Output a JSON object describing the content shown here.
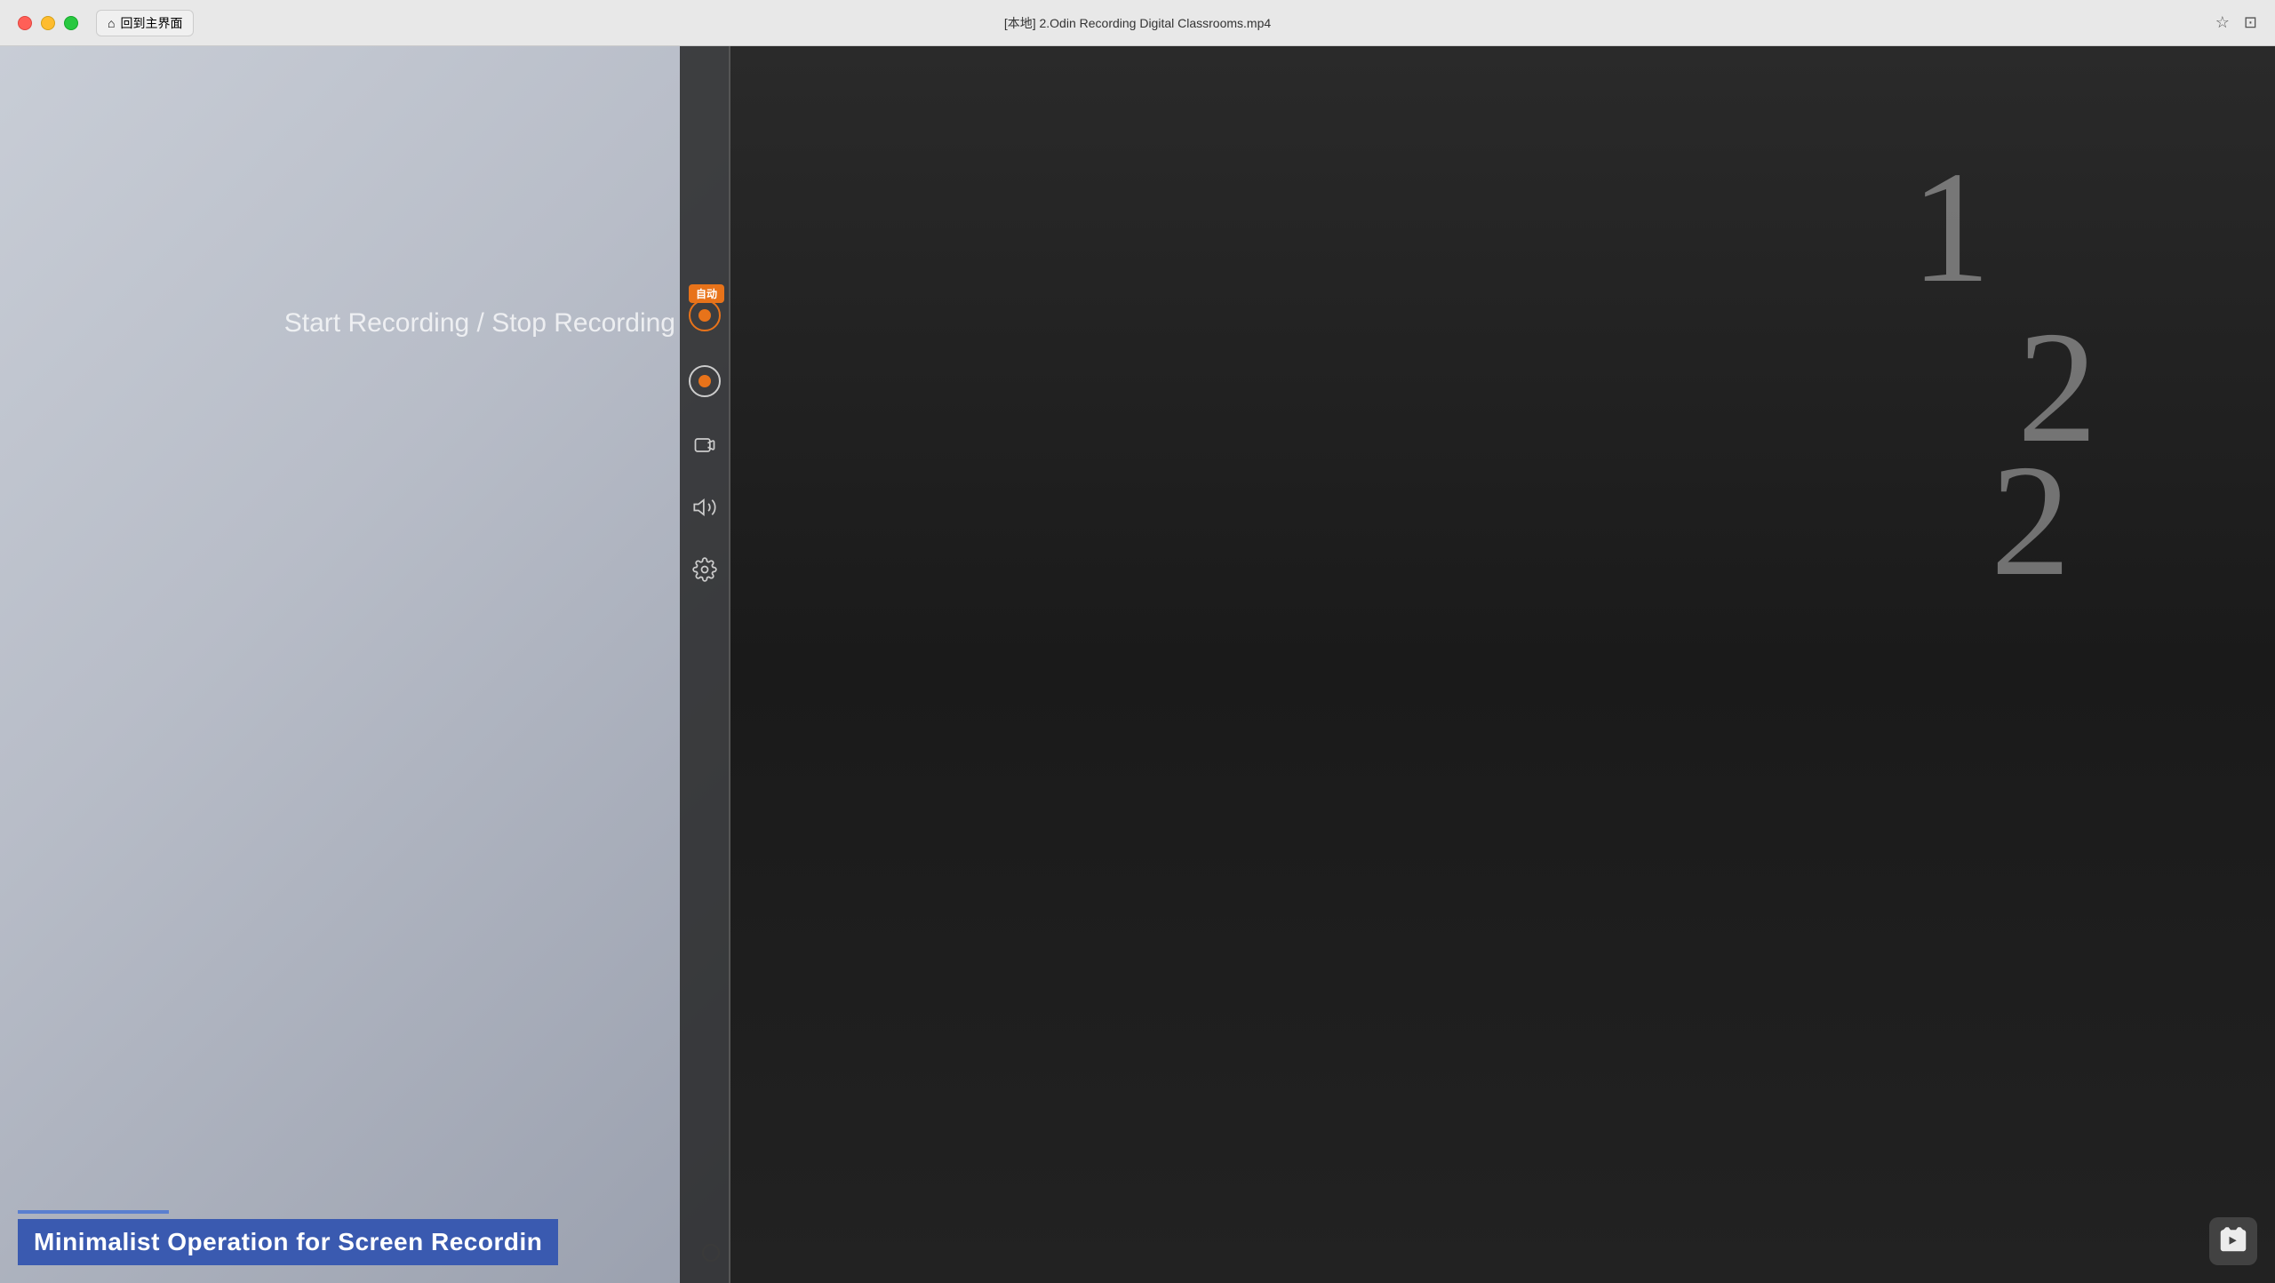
{
  "titlebar": {
    "title": "[本地] 2.Odin Recording Digital Classrooms.mp4",
    "home_button": "回到主界面",
    "traffic_lights": [
      "red",
      "yellow",
      "green"
    ]
  },
  "sidebar": {
    "auto_badge": "自动",
    "icons": [
      "record-top",
      "record-active",
      "camera",
      "volume",
      "settings"
    ],
    "recording_label": "Start Recording / Stop Recording"
  },
  "bottom_title": {
    "title_text": "Minimalist Operation for Screen Recordin",
    "progress_indicator": "●"
  },
  "chalk_numbers": [
    "1",
    "2",
    "2"
  ],
  "bilibili": {
    "icon": "▶"
  }
}
